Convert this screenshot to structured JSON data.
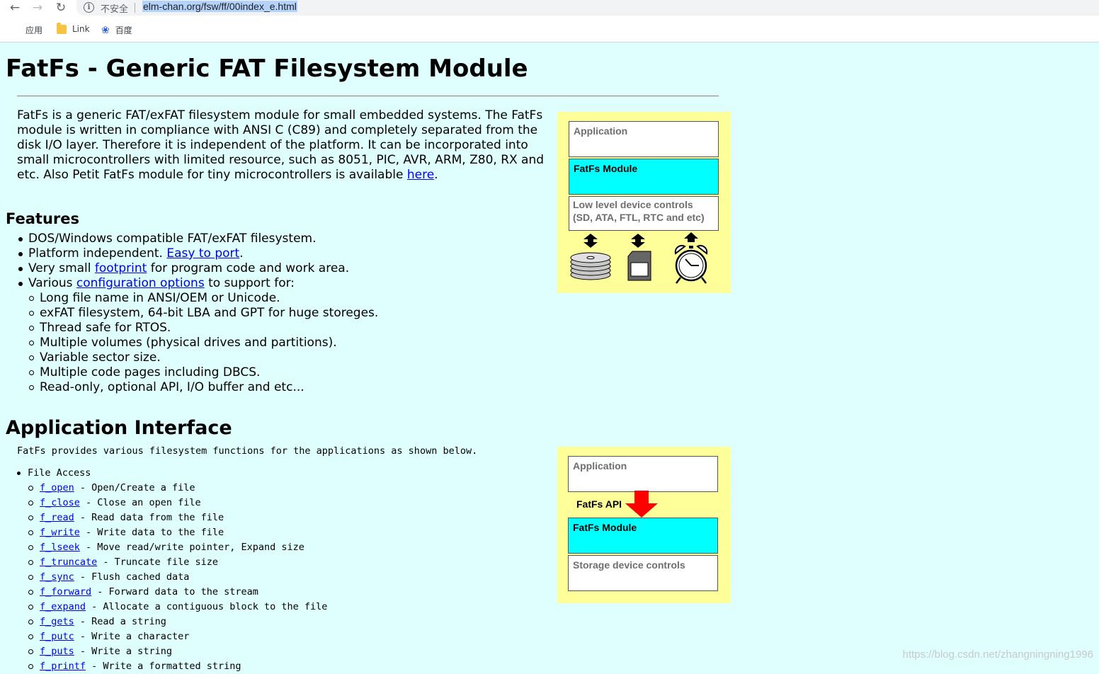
{
  "browser": {
    "insecure_label": "不安全",
    "url": "elm-chan.org/fsw/ff/00index_e.html",
    "bookmarks": [
      {
        "label": "应用",
        "icon": "apps-grid-icon"
      },
      {
        "label": "Link",
        "icon": "folder-icon"
      },
      {
        "label": "百度",
        "icon": "baidu-paw-icon"
      }
    ]
  },
  "page": {
    "title": "FatFs - Generic FAT Filesystem Module",
    "intro_part1": "FatFs is a generic FAT/exFAT filesystem module for small embedded systems. The FatFs module is written in compliance with ANSI C (C89) and completely separated from the disk I/O layer. Therefore it is independent of the platform. It can be incorporated into small microcontrollers with limited resource, such as 8051, PIC, AVR, ARM, Z80, RX and etc. Also Petit FatFs module for tiny microcontrollers is available ",
    "intro_link": "here",
    "intro_end": ".",
    "features": {
      "heading": "Features",
      "item1": "DOS/Windows compatible FAT/exFAT filesystem.",
      "item2_pre": "Platform independent. ",
      "item2_link": "Easy to port",
      "item2_post": ".",
      "item3_pre": "Very small ",
      "item3_link": "footprint",
      "item3_post": " for program code and work area.",
      "item4_pre": "Various ",
      "item4_link": "configuration options",
      "item4_post": " to support for:",
      "sub": [
        "Long file name in ANSI/OEM or Unicode.",
        "exFAT filesystem, 64-bit LBA and GPT for huge storeges.",
        "Thread safe for RTOS.",
        "Multiple volumes (physical drives and partitions).",
        "Variable sector size.",
        "Multiple code pages including DBCS.",
        "Read-only, optional API, I/O buffer and etc..."
      ]
    },
    "api": {
      "heading": "Application Interface",
      "intro": "FatFs provides various filesystem functions for the applications as shown below.",
      "group_label": "File Access",
      "functions": [
        {
          "name": "f_open",
          "desc": " - Open/Create a file"
        },
        {
          "name": "f_close",
          "desc": " - Close an open file"
        },
        {
          "name": "f_read",
          "desc": " - Read data from the file"
        },
        {
          "name": "f_write",
          "desc": " - Write data to the file"
        },
        {
          "name": "f_lseek",
          "desc": " - Move read/write pointer, Expand size"
        },
        {
          "name": "f_truncate",
          "desc": " - Truncate file size"
        },
        {
          "name": "f_sync",
          "desc": " - Flush cached data"
        },
        {
          "name": "f_forward",
          "desc": " - Forward data to the stream"
        },
        {
          "name": "f_expand",
          "desc": " - Allocate a contiguous block to the file"
        },
        {
          "name": "f_gets",
          "desc": " - Read a string"
        },
        {
          "name": "f_putc",
          "desc": " - Write a character"
        },
        {
          "name": "f_puts",
          "desc": " - Write a string"
        },
        {
          "name": "f_printf",
          "desc": " - Write a formatted string"
        }
      ]
    },
    "diagram1": {
      "application": "Application",
      "fatfs_module": "FatFs Module",
      "low_level_line1": "Low level device controls",
      "low_level_line2": "(SD, ATA, FTL, RTC and etc)"
    },
    "diagram2": {
      "application": "Application",
      "api_label": "FatFs API",
      "fatfs_module": "FatFs Module",
      "storage": "Storage device controls"
    },
    "watermark": "https://blog.csdn.net/zhangningning1996"
  },
  "colors": {
    "page_bg": "#dfffff",
    "link": "#0000ee",
    "diagram_bg": "#ffff9a",
    "module_block": "#00ffff",
    "api_arrow": "#ff0000",
    "url_highlight": "#b3d3fc"
  }
}
